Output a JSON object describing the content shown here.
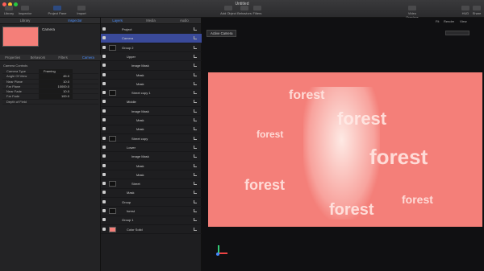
{
  "window": {
    "title": "Untitled"
  },
  "toolbar": {
    "library": "Library",
    "inspector": "Inspector",
    "project_pane": "Project Pane",
    "import": "Import",
    "add_object": "Add Object",
    "behaviors": "Behaviors",
    "filters": "Filters",
    "video_overlays": "Video Overlays",
    "fx": "fx",
    "hud": "HUD",
    "share": "Share"
  },
  "timecode": {
    "a": "0.000",
    "b": "0.000",
    "c": "0.000",
    "d": "100",
    "e": "-680px",
    "f": "-312px"
  },
  "left_tabs": [
    "Library",
    "Inspector"
  ],
  "preview_label": "Camera",
  "inspector_tabs": [
    "Properties",
    "Behaviors",
    "Filters",
    "Camera"
  ],
  "section": "Camera Controls",
  "params": [
    {
      "label": "Camera Type",
      "value": "Framing"
    },
    {
      "label": "Angle Of View",
      "value": "45.0"
    },
    {
      "label": "Near Plane",
      "value": "10.0"
    },
    {
      "label": "Far Plane",
      "value": "10000.0"
    },
    {
      "label": "Near Fade",
      "value": "10.0"
    },
    {
      "label": "Far Fade",
      "value": "100.0"
    },
    {
      "label": "Depth of Field",
      "value": ""
    }
  ],
  "layer_tabs": [
    "Layers",
    "Media",
    "Audio"
  ],
  "layers": [
    {
      "name": "Project"
    },
    {
      "name": "Camera"
    },
    {
      "name": "Group 2"
    },
    {
      "name": "Upper"
    },
    {
      "name": "Image Mask"
    },
    {
      "name": "Mask"
    },
    {
      "name": "Mask"
    },
    {
      "name": "Street copy 1"
    },
    {
      "name": "Middle"
    },
    {
      "name": "Image Mask"
    },
    {
      "name": "Mask"
    },
    {
      "name": "Mask"
    },
    {
      "name": "Street copy"
    },
    {
      "name": "Lower"
    },
    {
      "name": "Image Mask"
    },
    {
      "name": "Mask"
    },
    {
      "name": "Mask"
    },
    {
      "name": "Street"
    },
    {
      "name": "Mask"
    },
    {
      "name": "Group"
    },
    {
      "name": "forest"
    },
    {
      "name": "Group 1"
    },
    {
      "name": "Color Solid"
    }
  ],
  "canvas": {
    "camera_menu": "Active Camera",
    "render": "Render",
    "view": "View",
    "zoom": "Fit"
  },
  "image_words": [
    "forest"
  ]
}
